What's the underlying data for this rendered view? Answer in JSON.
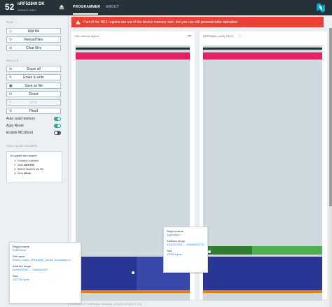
{
  "header": {
    "device_number": "52",
    "device_name": "nRF52840 DK",
    "device_serial": "000683712967",
    "tabs": [
      {
        "label": "PROGRAMMER",
        "active": true
      },
      {
        "label": "ABOUT",
        "active": false
      }
    ]
  },
  "sidebar": {
    "file_heading": "FILE",
    "file_buttons": [
      {
        "label": "Add file",
        "icon": "folder-icon"
      },
      {
        "label": "Reload files",
        "icon": "refresh-icon"
      },
      {
        "label": "Clear files",
        "icon": "minus-icon"
      }
    ],
    "device_heading": "DEVICE",
    "device_buttons": [
      {
        "label": "Erase all",
        "icon": "minus-icon"
      },
      {
        "label": "Erase & write",
        "icon": "pencil-icon"
      },
      {
        "label": "Save as file",
        "icon": "save-icon"
      },
      {
        "label": "Reset",
        "icon": "power-icon"
      },
      {
        "label": "Write",
        "icon": "pencil-icon",
        "disabled": true
      },
      {
        "label": "Read",
        "icon": "refresh-icon"
      }
    ],
    "toggles": [
      {
        "label": "Auto read memory",
        "on": true
      },
      {
        "label": "Auto Reset",
        "on": true
      },
      {
        "label": "Enable MCUboot",
        "on": false
      }
    ],
    "modem_heading": "CELLULAR MODEM",
    "modem_intro": "To update the modem",
    "modem_steps": [
      {
        "prefix": "1. Connect a device",
        "bold": ""
      },
      {
        "prefix": "2. Click ",
        "bold": "Add file"
      },
      {
        "prefix": "3. Select modem zip file",
        "bold": ""
      },
      {
        "prefix": "4. Click ",
        "bold": "Write"
      }
    ]
  },
  "banner": {
    "text": "Part of the HEX regions are out of the device memory size, but you can still proceed write operation",
    "color": "#ef4036"
  },
  "panels": {
    "left_title": "File memory layout",
    "right_title": "NRF52840_xxAA_REV2"
  },
  "colors": {
    "softdevice": "#283593",
    "application": "#43a047",
    "top_dark": "#263238",
    "top_red": "#e91e63",
    "bottom_orange": "#f57c00",
    "empty": "#cfd8dc"
  },
  "tooltip_softdevice": {
    "region_label": "Region name",
    "region_value": "SoftDevice",
    "file_label": "File name",
    "file_value": "Seeed_XIAO_nRF52840_Sense_bootloader-0...",
    "address_label": "Address range",
    "address_value": "0x00001000 — 0x00026497",
    "size_label": "Size",
    "size_value": "152728 bytes"
  },
  "tooltip_application": {
    "region_label": "Region name",
    "region_value": "Application",
    "address_label": "Address range",
    "address_value": "0x00027000 — 0x000300C73",
    "size_label": "Size",
    "size_value": "40052 bytes"
  },
  "status_text": "11:28:43.447    SoftDevice detected, id 0x125 (S140 v7.3.0)"
}
